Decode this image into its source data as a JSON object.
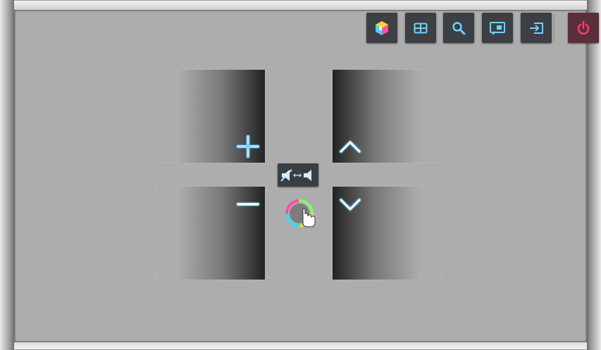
{
  "toolbar": {
    "buttons": [
      {
        "name": "smart-hub-cube",
        "icon": "cube-icon"
      },
      {
        "name": "grid",
        "icon": "grid-icon"
      },
      {
        "name": "search",
        "icon": "search-icon"
      },
      {
        "name": "screen-mirror",
        "icon": "screen-mirror-icon"
      },
      {
        "name": "source",
        "icon": "source-input-icon"
      },
      {
        "name": "power",
        "icon": "power-icon"
      }
    ]
  },
  "controls": {
    "volume_up_icon": "plus-icon",
    "volume_down_icon": "minus-icon",
    "channel_up_icon": "chevron-up-icon",
    "channel_down_icon": "chevron-down-icon",
    "mute_toggle_icon": "mute-toggle-icon",
    "pointer_icon": "color-ring-hand-icon"
  },
  "colors": {
    "screen_bg": "#adadad",
    "button_bg": "#3c3f44",
    "glow_blue": "#4fc3ff",
    "power_pink": "#ff3d7f"
  }
}
